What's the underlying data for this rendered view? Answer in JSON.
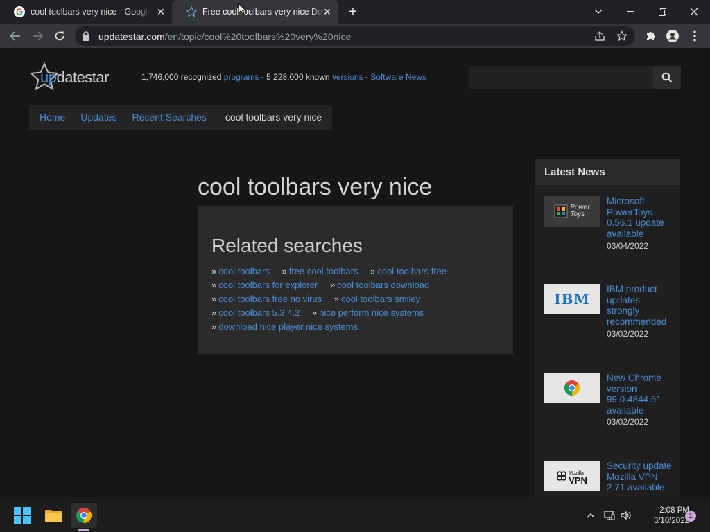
{
  "browser": {
    "tabs": [
      {
        "title": "cool toolbars very nice - Google Search",
        "active": false
      },
      {
        "title": "Free cool toolbars very nice Download",
        "active": true
      }
    ],
    "url_host": "updatestar.com",
    "url_path": "/en/topic/cool%20toolbars%20very%20nice"
  },
  "site": {
    "logo_text_up": "up",
    "logo_text_rest": "datestar",
    "stats": {
      "programs_count": "1,746,000 recognized",
      "programs_link": "programs",
      "sep1": " - ",
      "versions_count": "5,228,000 known",
      "versions_link": "versions",
      "sep2": " - ",
      "news_link": "Software News"
    },
    "search_placeholder": "",
    "nav": {
      "home": "Home",
      "updates": "Updates",
      "recent": "Recent Searches",
      "current": "cool toolbars very nice"
    }
  },
  "main": {
    "heading": "cool toolbars very nice",
    "related_title": "Related searches",
    "related": [
      [
        "cool toolbars",
        "free cool toolbars",
        "cool toolbars free"
      ],
      [
        "cool toolbars for explorer",
        "cool toolbars download"
      ],
      [
        "cool toolbars free no virus",
        "cool toolbars smiley"
      ],
      [
        "cool toolbars 5.3.4.2",
        "nice perform nice systems"
      ],
      [
        "download nice player nice systems"
      ]
    ],
    "bullet": "»"
  },
  "news": {
    "header": "Latest News",
    "items": [
      {
        "title": "Microsoft PowerToys 0.56.1 update available",
        "date": "03/04/2022",
        "thumb": "powertoys-logo",
        "thumb_text_1": "Power",
        "thumb_text_2": "Toys"
      },
      {
        "title": "IBM product updates strongly recommended",
        "date": "03/02/2022",
        "thumb": "ibm-logo",
        "thumb_text_1": "IBM"
      },
      {
        "title": "New Chrome version 99.0.4844.51 available",
        "date": "03/02/2022",
        "thumb": "chrome-logo"
      },
      {
        "title": "Security update Mozilla VPN 2.71 available",
        "date": "",
        "thumb": "mozilla-vpn-logo",
        "thumb_text_1": "Mozilla",
        "thumb_text_2": "VPN"
      }
    ]
  },
  "taskbar": {
    "time": "2:08 PM",
    "date": "3/10/2022",
    "notifications": "1"
  },
  "colors": {
    "link": "#4a8cd4",
    "page_bg": "#161616",
    "panel_bg": "#2b2b2b"
  }
}
